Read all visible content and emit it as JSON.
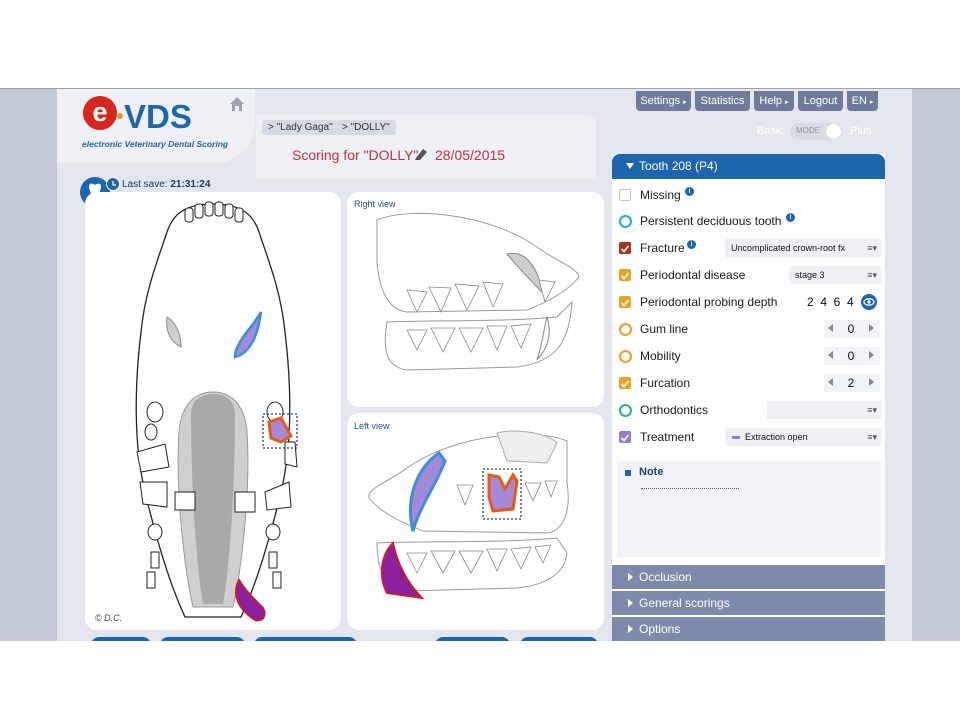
{
  "app": {
    "logo_letter": "e",
    "logo_name": "VDS",
    "logo_subtitle": "electronic Veterinary Dental Scoring"
  },
  "breadcrumb": [
    {
      "label": "> \"Lady Gaga\""
    },
    {
      "label": "> \"DOLLY\""
    }
  ],
  "header": {
    "scoring_title": "Scoring for \"DOLLY\"",
    "date": "28/05/2015",
    "last_save_label": "Last save:",
    "last_save_time": "21:31:24"
  },
  "topnav": {
    "items": [
      {
        "label": "Settings",
        "has_arrow": true
      },
      {
        "label": "Statistics",
        "has_arrow": false
      },
      {
        "label": "Help",
        "has_arrow": true
      },
      {
        "label": "Logout",
        "has_arrow": false
      },
      {
        "label": "EN",
        "has_arrow": true
      }
    ]
  },
  "mode": {
    "basic": "Basic",
    "toggle_text": "MODE",
    "plus": "Plus",
    "selected": "Plus"
  },
  "views": {
    "right_view_label": "Right view",
    "left_view_label": "Left view",
    "copyright": "© D.C."
  },
  "tooth_panel": {
    "title": "Tooth 208 (P4)",
    "rows": [
      {
        "label": "Missing",
        "has_info": true,
        "checked": false,
        "color": "#bfc4cf",
        "round": false
      },
      {
        "label": "Persistent deciduous tooth",
        "has_info": true,
        "checked": false,
        "color": "#1eb0c8",
        "round": true
      },
      {
        "label": "Fracture",
        "has_info": true,
        "checked": true,
        "color": "#a8321c",
        "round": false,
        "select": "Uncomplicated crown-root fx"
      },
      {
        "label": "Periodontal disease",
        "has_info": false,
        "checked": true,
        "color": "#f0a020",
        "round": false,
        "select": "stage 3"
      },
      {
        "label": "Periodontal probing depth",
        "has_info": false,
        "checked": true,
        "color": "#f0a020",
        "round": false,
        "values": "2  4  6  4"
      },
      {
        "label": "Gum line",
        "has_info": false,
        "checked": false,
        "color": "#f0a020",
        "round": true,
        "stepper": "0"
      },
      {
        "label": "Mobility",
        "has_info": false,
        "checked": false,
        "color": "#f0a020",
        "round": true,
        "stepper": "0"
      },
      {
        "label": "Furcation",
        "has_info": false,
        "checked": true,
        "color": "#f0a020",
        "round": false,
        "stepper": "2"
      },
      {
        "label": "Orthodontics",
        "has_info": false,
        "checked": false,
        "color": "#2cb08a",
        "round": true,
        "select": ""
      },
      {
        "label": "Treatment",
        "has_info": false,
        "checked": true,
        "color": "#9a7ad6",
        "round": false,
        "select": "Extraction open"
      }
    ],
    "note_title": "Note"
  },
  "accordion": [
    {
      "label": "Occlusion"
    },
    {
      "label": "General scorings"
    },
    {
      "label": "Options"
    }
  ],
  "colors": {
    "brand_blue": "#1d66ad",
    "brand_red": "#d7261e",
    "title_red": "#c0323c",
    "nav_gray": "#6f7c99",
    "accordion": "#7d8bab"
  }
}
